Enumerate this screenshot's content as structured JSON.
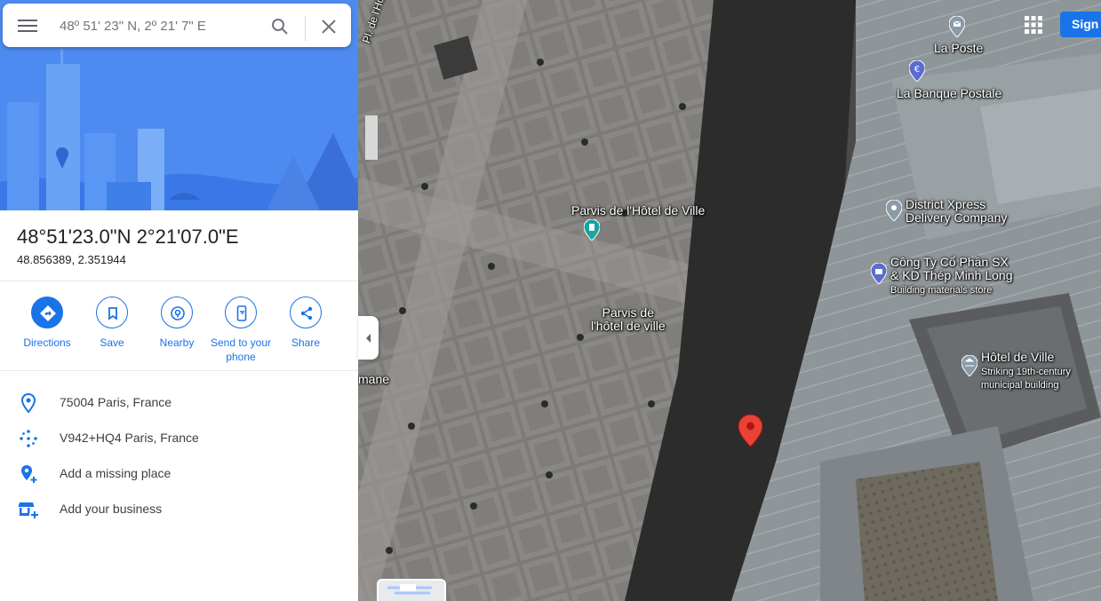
{
  "search": {
    "placeholder": "48º 51' 23\" N, 2º 21' 7\" E"
  },
  "place": {
    "title": "48°51'23.0\"N 2°21'07.0\"E",
    "decimal": "48.856389, 2.351944"
  },
  "actions": [
    {
      "label": "Directions",
      "icon": "directions-icon"
    },
    {
      "label": "Save",
      "icon": "bookmark-icon"
    },
    {
      "label": "Nearby",
      "icon": "nearby-icon"
    },
    {
      "label": "Send to your\nphone",
      "icon": "phone-icon"
    },
    {
      "label": "Share",
      "icon": "share-icon"
    }
  ],
  "info": [
    {
      "text": "75004 Paris, France",
      "icon": "location-pin-icon"
    },
    {
      "text": "V942+HQ4 Paris, France",
      "icon": "plus-code-icon"
    },
    {
      "text": "Add a missing place",
      "icon": "add-place-icon"
    },
    {
      "text": "Add your business",
      "icon": "add-business-icon"
    }
  ],
  "header": {
    "signin_label": "Sign i"
  },
  "map": {
    "labels": {
      "street": "Pl. de l'Hôtel de Ville",
      "la_poste": "La Poste",
      "banque": "La Banque Postale",
      "parvis_poi": "Parvis de l'Hôtel de Ville",
      "parvis_area_1": "Parvis de",
      "parvis_area_2": "l'hôtel de ville",
      "district_1": "District Xpress",
      "district_2": "Delivery Company",
      "congty_1": "Công Ty Cổ Phần SX",
      "congty_2": "& KD Thép Minh Long",
      "congty_sub": "Building materials store",
      "hdv_title": "Hôtel de Ville",
      "hdv_sub_1": "Striking 19th-century",
      "hdv_sub_2": "municipal building",
      "mane": "mane"
    }
  },
  "colors": {
    "accent": "#1a73e8",
    "pin_red": "#ea4335",
    "poi_blue": "#5b6dcd",
    "poi_teal": "#1aa3a0",
    "poi_gray": "#8a9aa8"
  }
}
